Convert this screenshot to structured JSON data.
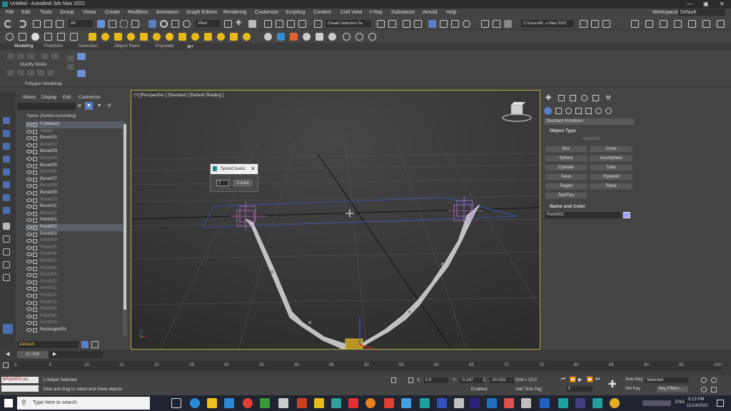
{
  "window": {
    "title": "Untitled - Autodesk 3ds Max 2022",
    "workspace_label": "Workspaces:",
    "workspace_value": "Default"
  },
  "menu": [
    "File",
    "Edit",
    "Tools",
    "Group",
    "Views",
    "Create",
    "Modifiers",
    "Animation",
    "Graph Editors",
    "Rendering",
    "Customize",
    "Scripting",
    "Content",
    "Civil View",
    "V-Ray",
    "Substance",
    "Arnold",
    "Help"
  ],
  "toolbar": {
    "filter_value": "All",
    "view_value": "View",
    "selection_set": "Create Selection Se",
    "path_value": "C:\\Users\\M...s Max 2022"
  },
  "ribbon": {
    "tabs": [
      "Modeling",
      "Freeform",
      "Selection",
      "Object Paint",
      "Populate"
    ],
    "mode_label": "Modify Mode",
    "panel_label": "Polygon Modeling"
  },
  "scene_explorer": {
    "menu": [
      "Select",
      "Display",
      "Edit",
      "Customize"
    ],
    "header": "Name (Sorted Ascending)",
    "items": [
      {
        "name": "0 (default)",
        "style": "sel"
      },
      {
        "name": "Hidden",
        "style": "dim"
      },
      {
        "name": "Bone001",
        "style": ""
      },
      {
        "name": "Bone002",
        "style": "dim"
      },
      {
        "name": "Bone003",
        "style": ""
      },
      {
        "name": "Bone004",
        "style": "dim"
      },
      {
        "name": "Bone005",
        "style": ""
      },
      {
        "name": "Bone006",
        "style": "dim"
      },
      {
        "name": "Bone007",
        "style": ""
      },
      {
        "name": "Bone008",
        "style": "dim"
      },
      {
        "name": "Bone009",
        "style": ""
      },
      {
        "name": "Bone010",
        "style": "dim"
      },
      {
        "name": "Bone011",
        "style": ""
      },
      {
        "name": "Bone012",
        "style": "dim"
      },
      {
        "name": "Point001",
        "style": ""
      },
      {
        "name": "Point002",
        "style": "sel"
      },
      {
        "name": "Point003",
        "style": ""
      },
      {
        "name": "Point004",
        "style": "dim"
      },
      {
        "name": "Point005",
        "style": "dim"
      },
      {
        "name": "Point006",
        "style": "dim"
      },
      {
        "name": "Point007",
        "style": "dim"
      },
      {
        "name": "Point008",
        "style": "dim"
      },
      {
        "name": "Point009",
        "style": "dim"
      },
      {
        "name": "Point010",
        "style": "dim"
      },
      {
        "name": "Point011",
        "style": "dim"
      },
      {
        "name": "Point012",
        "style": "dim"
      },
      {
        "name": "Point013",
        "style": "dim"
      },
      {
        "name": "Point014",
        "style": "dim"
      },
      {
        "name": "Point015",
        "style": "dim"
      },
      {
        "name": "Point016",
        "style": "dim"
      },
      {
        "name": "Rectangle001",
        "style": ""
      }
    ],
    "layer": "Default"
  },
  "viewport": {
    "label": "[+] [Perspective ] [Standard ] [Default Shading ]",
    "dialog_title": "SpineCreator",
    "dialog_input": "7",
    "dialog_button": "Create"
  },
  "command_panel": {
    "category": "Standard Primitives",
    "object_type_header": "Object Type",
    "autogrid": "AutoGrid",
    "buttons": [
      "Box",
      "Cone",
      "Sphere",
      "GeoSphere",
      "Cylinder",
      "Tube",
      "Torus",
      "Pyramid",
      "Teapot",
      "Plane",
      "TextPlus"
    ],
    "name_color_header": "Name and Color",
    "object_name": "Point002",
    "object_color": "#a6a0ff"
  },
  "timeline": {
    "frame_label": "0 / 100",
    "ticks": [
      "0",
      "5",
      "10",
      "15",
      "20",
      "25",
      "30",
      "35",
      "40",
      "45",
      "50",
      "55",
      "60",
      "65",
      "70",
      "75",
      "80",
      "85",
      "90",
      "95",
      "100"
    ]
  },
  "status": {
    "script_field": "$Point002.po",
    "selection_info": "1 Helper Selected",
    "prompt": "Click and drag to select and move objects",
    "x_label": "X:",
    "x_value": "0.0",
    "y_label": "Y:",
    "y_value": "-0.187",
    "z_label": "Z:",
    "z_value": "-20.002",
    "grid": "Grid = 10.0",
    "enabled": "Enabled:",
    "add_time_tag": "Add Time Tag",
    "frame_value": "0",
    "auto_key": "Auto Key",
    "set_key": "Set Key",
    "key_mode": "Selected",
    "key_filters": "Key Filters..."
  },
  "taskbar": {
    "search_placeholder": "Type here to search",
    "language": "ENG",
    "time": "6:13 PM",
    "date": "11/14/2022"
  }
}
